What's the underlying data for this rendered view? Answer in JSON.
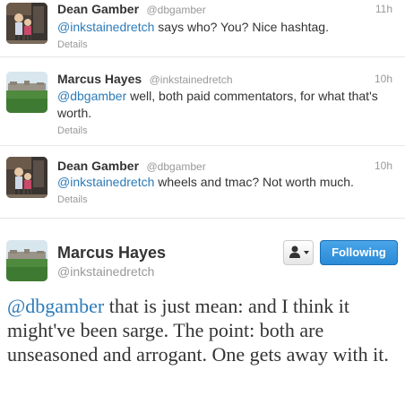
{
  "tweets": [
    {
      "fullname": "Dean Gamber",
      "username": "@dbgamber",
      "time": "11h",
      "mention": "@inkstainedretch",
      "text": " says who? You? Nice hashtag.",
      "details": "Details",
      "avatar": "dean-gamber-avatar"
    },
    {
      "fullname": "Marcus Hayes",
      "username": "@inkstainedretch",
      "time": "10h",
      "mention": "@dbgamber",
      "text": " well, both paid commentators, for what that's worth.",
      "details": "Details",
      "avatar": "marcus-hayes-avatar"
    },
    {
      "fullname": "Dean Gamber",
      "username": "@dbgamber",
      "time": "10h",
      "mention": "@inkstainedretch",
      "text": " wheels and tmac? Not worth much.",
      "details": "Details",
      "avatar": "dean-gamber-avatar"
    }
  ],
  "main_tweet": {
    "fullname": "Marcus Hayes",
    "username": "@inkstainedretch",
    "follow_label": "Following",
    "mention": "@dbgamber",
    "text": " that is just mean: and I think it might've been sarge. The point: both are unseasoned and arrogant. One gets away with it."
  },
  "colors": {
    "link": "#2b7bb9",
    "follow_button": "#2a8bd6",
    "muted": "#999999"
  }
}
